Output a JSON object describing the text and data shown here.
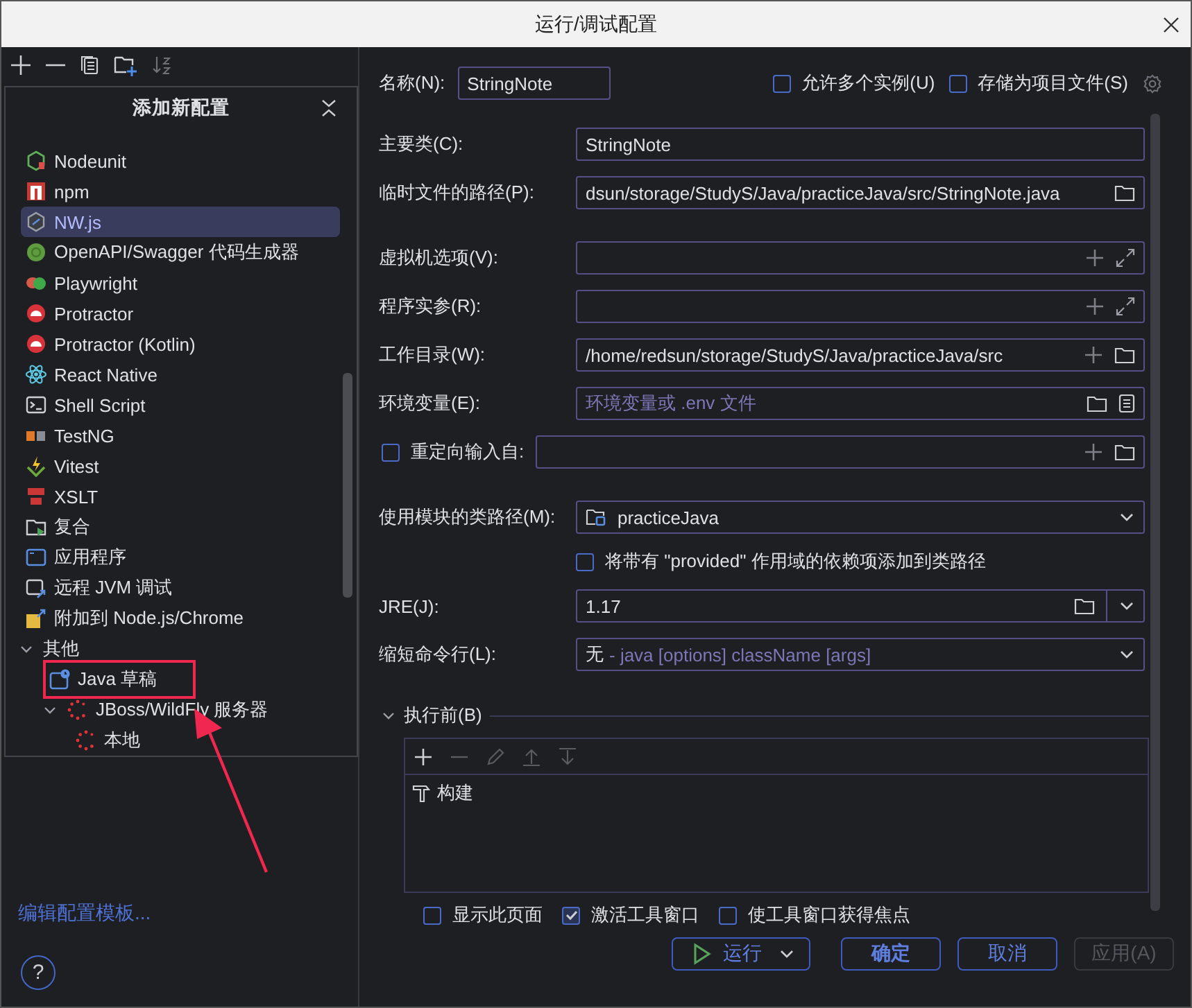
{
  "window": {
    "title": "运行/调试配置"
  },
  "add_panel": {
    "title": "添加新配置",
    "items": [
      {
        "label": "Nodeunit",
        "selected": false,
        "annotated": false
      },
      {
        "label": "npm",
        "selected": false,
        "annotated": false
      },
      {
        "label": "NW.js",
        "selected": true,
        "annotated": false
      },
      {
        "label": "OpenAPI/Swagger 代码生成器",
        "selected": false,
        "annotated": false
      },
      {
        "label": "Playwright",
        "selected": false,
        "annotated": false
      },
      {
        "label": "Protractor",
        "selected": false,
        "annotated": false
      },
      {
        "label": "Protractor (Kotlin)",
        "selected": false,
        "annotated": false
      },
      {
        "label": "React Native",
        "selected": false,
        "annotated": false
      },
      {
        "label": "Shell Script",
        "selected": false,
        "annotated": false
      },
      {
        "label": "TestNG",
        "selected": false,
        "annotated": false
      },
      {
        "label": "Vitest",
        "selected": false,
        "annotated": false
      },
      {
        "label": "XSLT",
        "selected": false,
        "annotated": false
      },
      {
        "label": "复合",
        "selected": false,
        "annotated": false
      },
      {
        "label": "应用程序",
        "selected": false,
        "annotated": false
      },
      {
        "label": "远程 JVM 调试",
        "selected": false,
        "annotated": false
      },
      {
        "label": "附加到 Node.js/Chrome",
        "selected": false,
        "annotated": false
      },
      {
        "label": "其他",
        "selected": false,
        "annotated": false,
        "expanded": true,
        "children": [
          {
            "label": "Java 草稿",
            "selected": false,
            "annotated": true
          },
          {
            "label": "JBoss/WildFly 服务器",
            "selected": false,
            "annotated": false,
            "expanded": true,
            "children": [
              {
                "label": "本地",
                "selected": false,
                "annotated": false
              }
            ]
          }
        ]
      }
    ]
  },
  "edit_templates_link": "编辑配置模板...",
  "help_button": "?",
  "form": {
    "name": {
      "label": "名称(N):",
      "value": "StringNote"
    },
    "options": [
      {
        "label": "允许多个实例(U)",
        "checked": false
      },
      {
        "label": "存储为项目文件(S)",
        "checked": false
      }
    ],
    "row_groups": [
      [
        {
          "kind": "text",
          "label": "主要类(C):",
          "value": "StringNote"
        },
        {
          "kind": "file",
          "label": "临时文件的路径(P):",
          "value": "dsun/storage/StudyS/Java/practiceJava/src/StringNote.java"
        }
      ],
      [
        {
          "kind": "expandable",
          "label": "虚拟机选项(V):"
        },
        {
          "kind": "expandable",
          "label": "程序实参(R):"
        },
        {
          "kind": "directory",
          "label": "工作目录(W):",
          "value": "/home/redsun/storage/StudyS/Java/practiceJava/src"
        },
        {
          "kind": "env",
          "label": "环境变量(E):",
          "placeholder": "环境变量或 .env 文件"
        },
        {
          "kind": "redirect",
          "label": "重定向输入自:",
          "checked": false
        }
      ],
      [
        {
          "kind": "module",
          "label": "使用模块的类路径(M):",
          "value": "practiceJava"
        },
        {
          "kind": "checkbox",
          "label": "将带有 \"provided\" 作用域的依赖项添加到类路径",
          "checked": false
        },
        {
          "kind": "jre",
          "label": "JRE(J):",
          "value": "1.17"
        },
        {
          "kind": "select",
          "label": "缩短命令行(L):",
          "value": "无",
          "hint": "- java [options] className [args]"
        }
      ]
    ]
  },
  "before_launch": {
    "title": "执行前(B)",
    "expanded": true,
    "tasks": [
      {
        "label": "构建"
      }
    ]
  },
  "launch_options": [
    {
      "label": "显示此页面",
      "checked": false
    },
    {
      "label": "激活工具窗口",
      "checked": true
    },
    {
      "label": "使工具窗口获得焦点",
      "checked": false
    }
  ],
  "buttons": [
    {
      "label": "运行",
      "kind": "run",
      "disabled": false
    },
    {
      "label": "确定",
      "kind": "default",
      "disabled": false
    },
    {
      "label": "取消",
      "kind": "normal",
      "disabled": false
    },
    {
      "label": "应用(A)",
      "kind": "normal",
      "disabled": true
    }
  ]
}
